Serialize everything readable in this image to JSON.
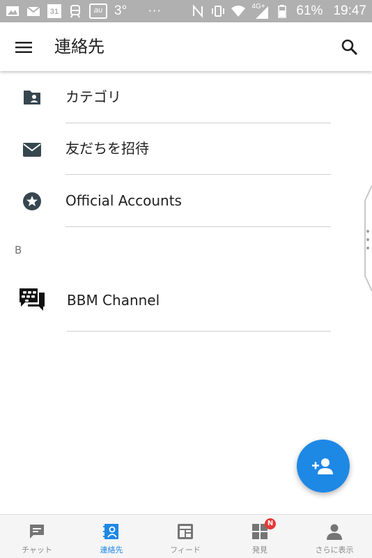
{
  "status_bar": {
    "calendar_day": "31",
    "au_label": "au",
    "temperature": "3°",
    "more": "···",
    "network": "4G+",
    "battery": "61%",
    "time": "19:47"
  },
  "app_bar": {
    "title": "連絡先"
  },
  "list": {
    "items": [
      {
        "label": "カテゴリ",
        "icon": "contact-folder-icon"
      },
      {
        "label": "友だちを招待",
        "icon": "mail-icon"
      },
      {
        "label": "Official Accounts",
        "icon": "star-badge-icon"
      }
    ],
    "section": "B",
    "contacts": [
      {
        "label": "BBM Channel",
        "icon": "bbm-icon"
      }
    ]
  },
  "fab": {
    "icon": "add-person-icon"
  },
  "bottom_nav": {
    "tabs": [
      {
        "label": "チャット",
        "icon": "chat-icon"
      },
      {
        "label": "連絡先",
        "icon": "contacts-icon",
        "active": true
      },
      {
        "label": "フィード",
        "icon": "feed-icon"
      },
      {
        "label": "発見",
        "icon": "discover-icon",
        "badge": "N"
      },
      {
        "label": "さらに表示",
        "icon": "profile-icon"
      }
    ]
  },
  "colors": {
    "accent": "#1e88e5",
    "status_bar": "#b0b0b0",
    "badge": "#e53935"
  }
}
